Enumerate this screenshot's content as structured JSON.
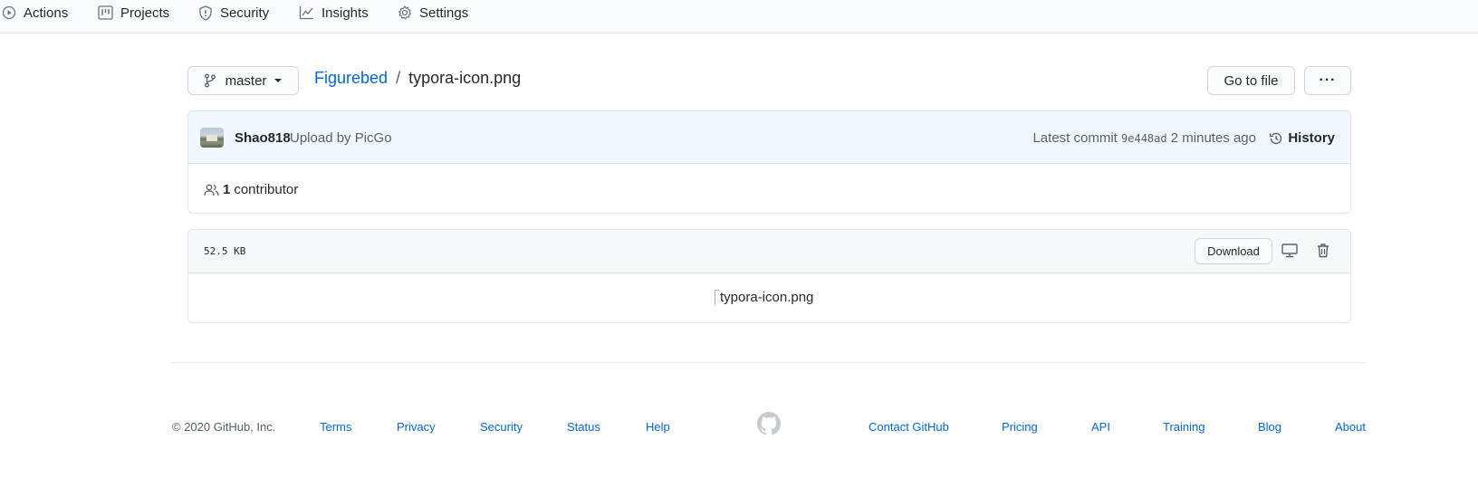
{
  "nav": {
    "items": [
      {
        "label": "Actions",
        "icon": "play-circle-icon"
      },
      {
        "label": "Projects",
        "icon": "project-board-icon"
      },
      {
        "label": "Security",
        "icon": "shield-icon"
      },
      {
        "label": "Insights",
        "icon": "graph-icon"
      },
      {
        "label": "Settings",
        "icon": "gear-icon"
      }
    ]
  },
  "branch": {
    "name": "master"
  },
  "breadcrumb": {
    "repo": "Figurebed",
    "separator": "/",
    "file": "typora-icon.png"
  },
  "actions": {
    "go_to_file": "Go to file",
    "more": "···"
  },
  "commit": {
    "author": "Shao818",
    "message": "Upload by PicGo",
    "latest_prefix": "Latest commit",
    "sha": "9e448ad",
    "time": "2 minutes ago",
    "history_label": "History"
  },
  "contributors": {
    "count": "1",
    "label": "contributor"
  },
  "file": {
    "size": "52.5 KB",
    "download_label": "Download",
    "image_alt": "typora-icon.png"
  },
  "footer": {
    "copyright": "© 2020 GitHub, Inc.",
    "left_links": [
      "Terms",
      "Privacy",
      "Security",
      "Status",
      "Help"
    ],
    "right_links": [
      "Contact GitHub",
      "Pricing",
      "API",
      "Training",
      "Blog",
      "About"
    ]
  },
  "colors": {
    "link": "#0366d6",
    "commit_bg": "#f1f8ff",
    "header_bg": "#f6f8fa",
    "border": "#e1e4e8"
  }
}
